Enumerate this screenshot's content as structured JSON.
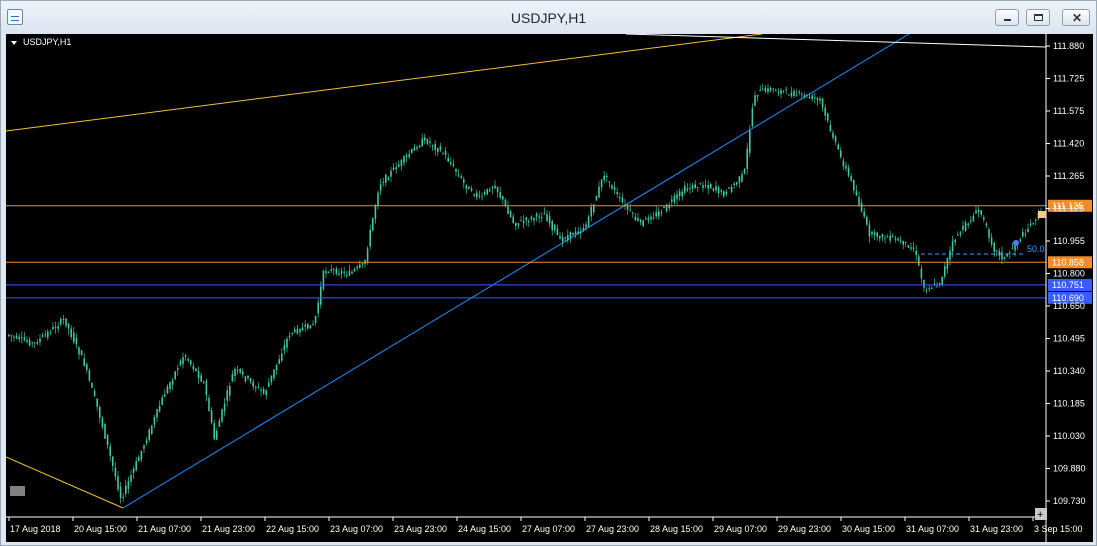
{
  "window": {
    "title": "USDJPY,H1"
  },
  "chart_data": {
    "type": "candlestick",
    "symbol_label": "USDJPY,H1",
    "y_ticks": [
      "111.880",
      "111.725",
      "111.575",
      "111.420",
      "111.265",
      "111.125",
      "110.955",
      "110.800",
      "110.650",
      "110.495",
      "110.340",
      "110.185",
      "110.030",
      "109.880",
      "109.730"
    ],
    "y_range": [
      109.73,
      111.88
    ],
    "x_ticks": [
      "17 Aug 2018",
      "20 Aug 15:00",
      "21 Aug 07:00",
      "21 Aug 23:00",
      "22 Aug 15:00",
      "23 Aug 07:00",
      "23 Aug 23:00",
      "24 Aug 15:00",
      "27 Aug 07:00",
      "27 Aug 23:00",
      "28 Aug 15:00",
      "29 Aug 07:00",
      "29 Aug 23:00",
      "30 Aug 15:00",
      "31 Aug 07:00",
      "31 Aug 23:00",
      "3 Sep 15:00"
    ],
    "hlines": [
      {
        "label": "111.125",
        "value": 111.125,
        "color": "#f28c28",
        "tag_bg": "#f28c28"
      },
      {
        "label": "110.858",
        "value": 110.858,
        "color": "#f28c28",
        "tag_bg": "#f28c28"
      },
      {
        "label": "110.751",
        "value": 110.751,
        "color": "#3a5cff",
        "tag_bg": "#3a5cff"
      },
      {
        "label": "110.690",
        "value": 110.69,
        "color": "#3a5cff",
        "tag_bg": "#3a5cff"
      }
    ],
    "fib_label": "50.0",
    "candle_color": "#40c8a0",
    "trendline_color": "#1e90ff",
    "channel_color": "#f0c040"
  }
}
